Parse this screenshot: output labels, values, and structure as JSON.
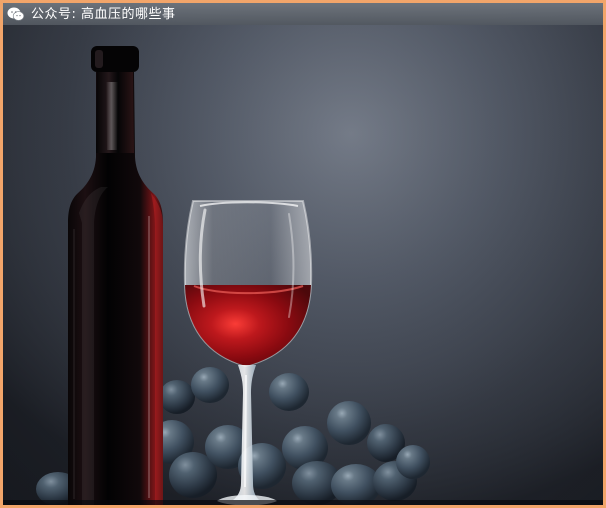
{
  "watermark": {
    "text": "公众号: 高血压的哪些事",
    "icon": "wechat-icon"
  },
  "scene": {
    "subject": "wine-bottle-glass-grapes",
    "colors": {
      "background_dark": "#1d2027",
      "background_mid": "#525966",
      "frame": "#f2a56a",
      "wine_red": "#b01417",
      "grape_blue": "#51606f"
    }
  }
}
